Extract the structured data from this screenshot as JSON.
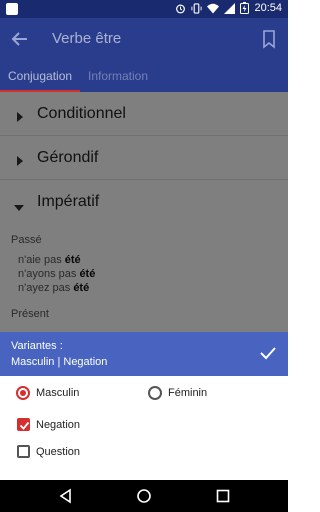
{
  "statusbar": {
    "time": "20:54"
  },
  "toolbar": {
    "title": "Verbe être"
  },
  "tabs": [
    {
      "label": "Conjugation"
    },
    {
      "label": "Information"
    }
  ],
  "sections": [
    {
      "label": "Conditionnel"
    },
    {
      "label": "Gérondif"
    },
    {
      "label": "Impératif"
    }
  ],
  "imperatif": {
    "passe_label": "Passé",
    "passe_rows": [
      {
        "prefix": "n'aie pas",
        "verb": "été"
      },
      {
        "prefix": "n'ayons pas",
        "verb": "été"
      },
      {
        "prefix": "n'ayez pas",
        "verb": "été"
      }
    ],
    "present_label": "Présent"
  },
  "sheet": {
    "header_title": "Variantes :",
    "header_value": "Masculin | Negation",
    "options": {
      "masculin": "Masculin",
      "feminin": "Féminin",
      "negation": "Negation",
      "question": "Question"
    }
  },
  "colors": {
    "primary": "#2a3c8c",
    "header": "#4864c0",
    "accent": "#d32f2f"
  }
}
